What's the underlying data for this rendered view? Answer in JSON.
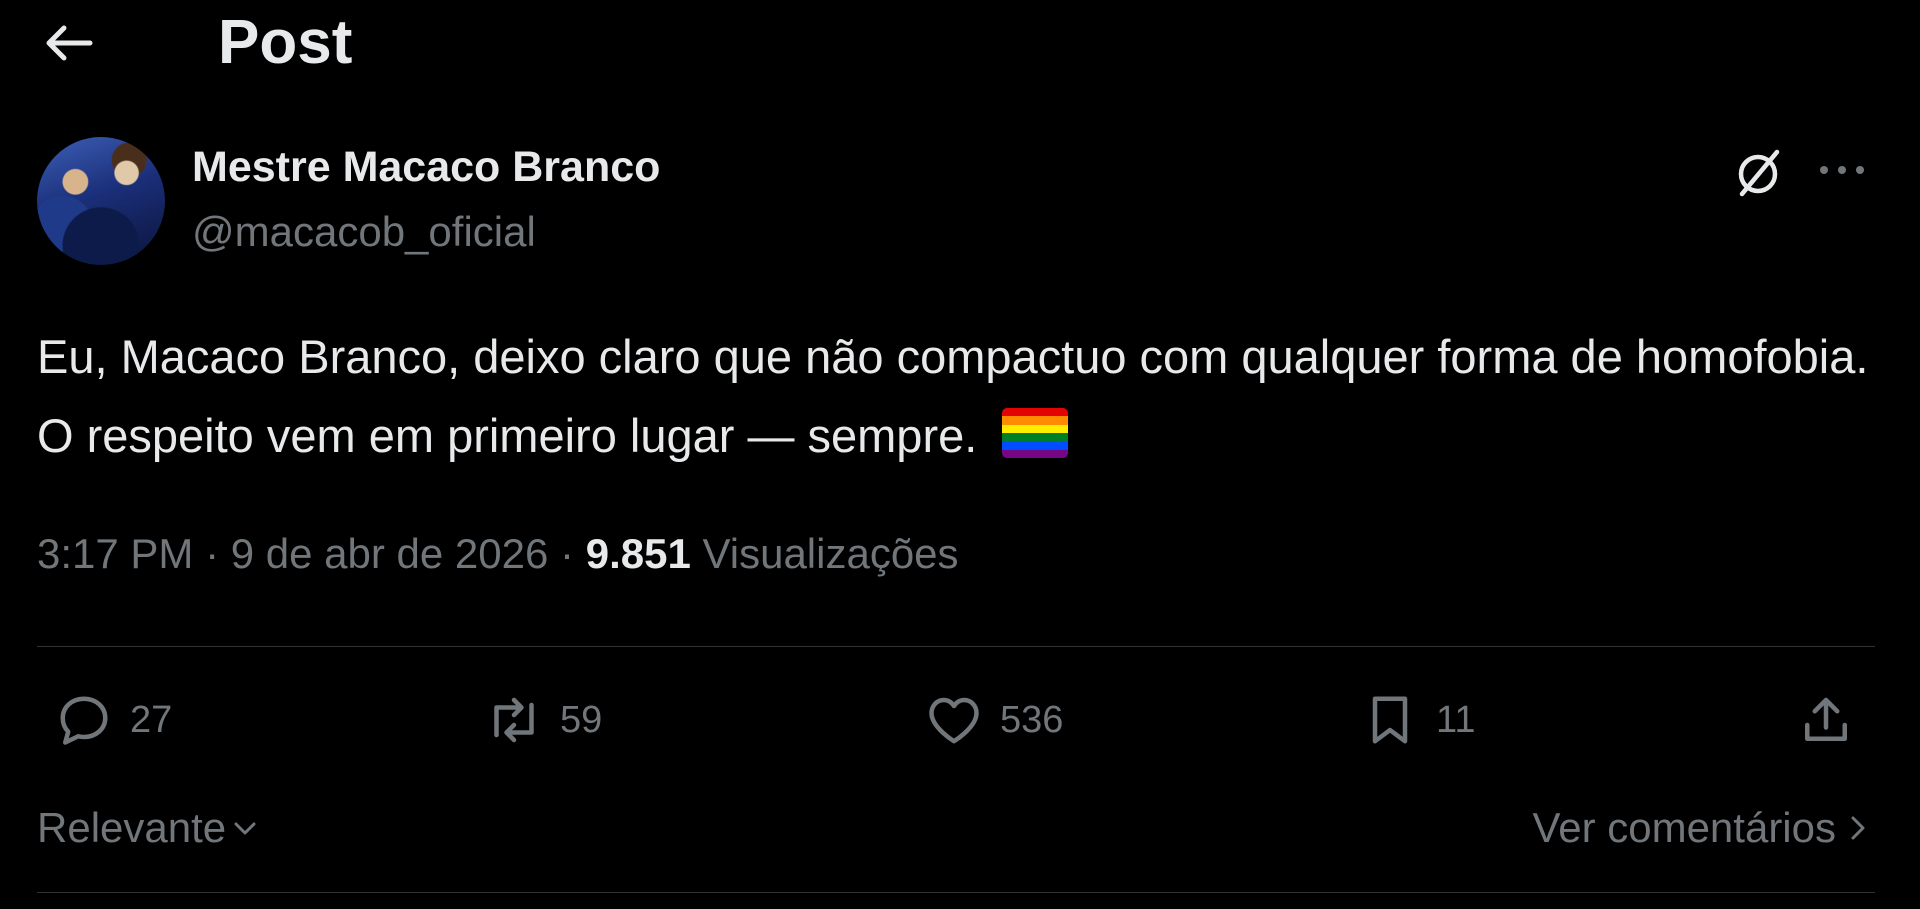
{
  "header": {
    "title": "Post",
    "back_icon": "arrow-left-icon"
  },
  "author": {
    "display_name": "Mestre Macaco Branco",
    "handle": "@macacob_oficial"
  },
  "post": {
    "text": "Eu, Macaco Branco, deixo claro que não compactuo com qualquer forma de homofobia. O respeito vem em primeiro lugar — sempre.",
    "emoji": "rainbow-flag",
    "flag_colors": [
      "#e40303",
      "#ff8c00",
      "#ffed00",
      "#008026",
      "#004dff",
      "#750787"
    ],
    "time": "3:17 PM",
    "date": "9 de abr de 2026",
    "separator": "·",
    "views_count": "9.851",
    "views_label": "Visualizações"
  },
  "actions": {
    "replies": "27",
    "reposts": "59",
    "likes": "536",
    "bookmarks": "11"
  },
  "comments_bar": {
    "sort_label": "Relevante",
    "see_comments": "Ver comentários"
  },
  "colors": {
    "background": "#000000",
    "text_primary": "#e7e9ea",
    "text_secondary": "#71767b",
    "divider": "#2f3336"
  }
}
